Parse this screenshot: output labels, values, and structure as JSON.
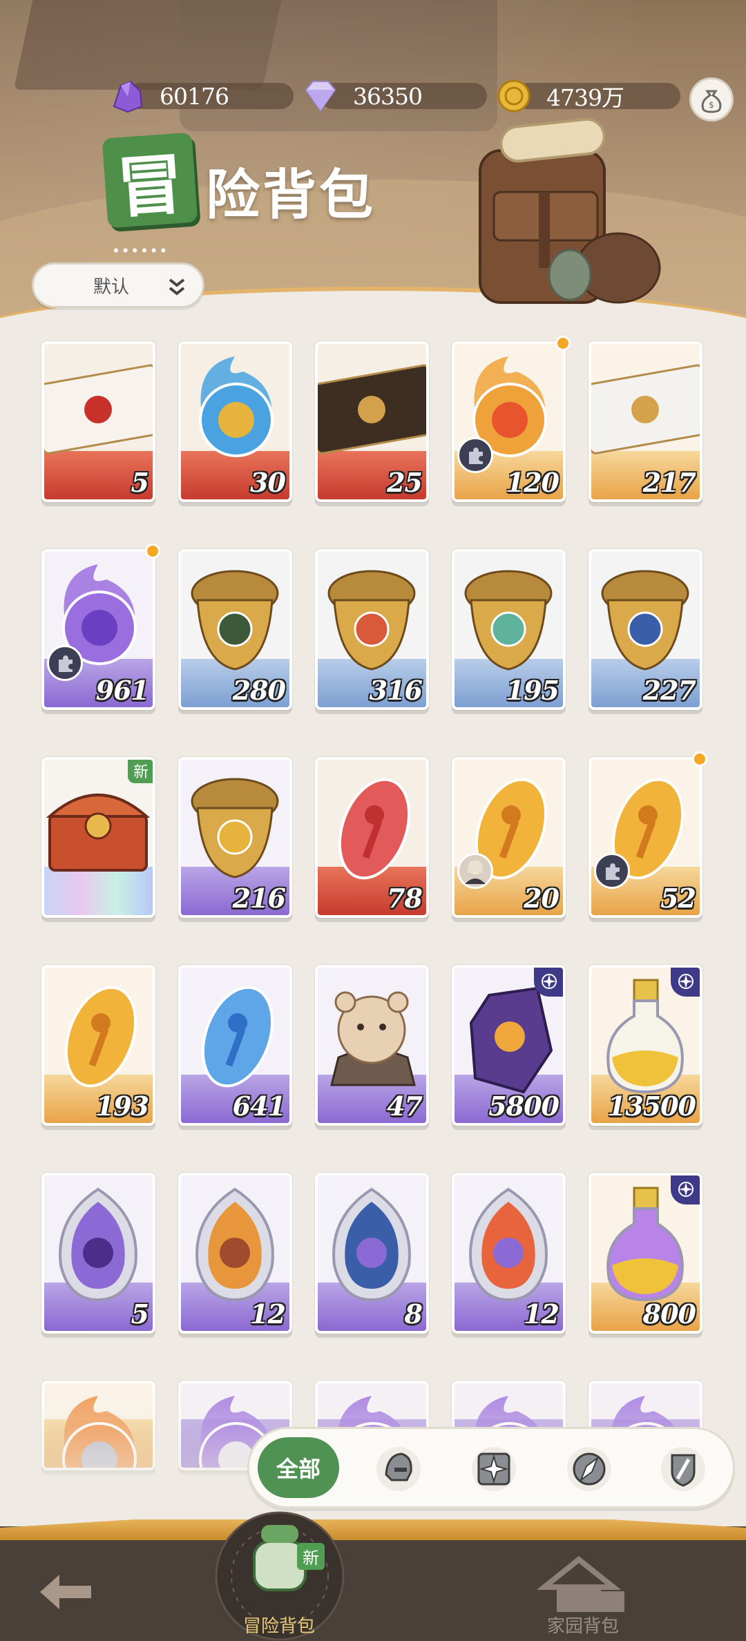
{
  "currencies": [
    {
      "name": "purple-crystal",
      "value": "60176",
      "color": "#8e5bd6"
    },
    {
      "name": "diamond",
      "value": "36350",
      "color": "#c9b8f0"
    },
    {
      "name": "gold-coin",
      "value": "4739万",
      "color": "#e0b030"
    }
  ],
  "title": {
    "badge": "冒",
    "rest": "险背包",
    "dots": "••••••"
  },
  "sort": {
    "label": "默认"
  },
  "items": [
    {
      "count": "5",
      "theme": "red",
      "art": "envelope-red",
      "dot": false,
      "puzzle": false
    },
    {
      "count": "30",
      "theme": "red",
      "art": "crystal-ball",
      "dot": false,
      "puzzle": false
    },
    {
      "count": "25",
      "theme": "red",
      "art": "envelope-dark",
      "dot": false,
      "puzzle": false
    },
    {
      "count": "120",
      "theme": "gold",
      "art": "fire-trident-orb",
      "dot": true,
      "puzzle": true
    },
    {
      "count": "217",
      "theme": "gold",
      "art": "envelope-white",
      "dot": false,
      "puzzle": false
    },
    {
      "count": "961",
      "theme": "purple",
      "art": "purple-trident-orb",
      "dot": true,
      "puzzle": true
    },
    {
      "count": "280",
      "theme": "blue",
      "art": "acorn-eye",
      "dot": false,
      "puzzle": false
    },
    {
      "count": "316",
      "theme": "blue",
      "art": "acorn-sun",
      "dot": false,
      "puzzle": false
    },
    {
      "count": "195",
      "theme": "blue",
      "art": "acorn-leaf",
      "dot": false,
      "puzzle": false
    },
    {
      "count": "227",
      "theme": "blue",
      "art": "acorn-star",
      "dot": false,
      "puzzle": false
    },
    {
      "count": "",
      "theme": "rainbow",
      "art": "treasure-chest",
      "dot": false,
      "puzzle": false,
      "new": "新"
    },
    {
      "count": "216",
      "theme": "purple",
      "art": "acorn-diamond",
      "dot": false,
      "puzzle": false
    },
    {
      "count": "78",
      "theme": "red",
      "art": "red-seed",
      "dot": false,
      "puzzle": false
    },
    {
      "count": "20",
      "theme": "gold",
      "art": "gold-seed",
      "dot": false,
      "puzzle": false,
      "portrait": true
    },
    {
      "count": "52",
      "theme": "gold",
      "art": "gold-seed",
      "dot": true,
      "puzzle": true
    },
    {
      "count": "193",
      "theme": "gold",
      "art": "gold-seed",
      "dot": false,
      "puzzle": false
    },
    {
      "count": "641",
      "theme": "purple",
      "art": "blue-seed",
      "dot": false,
      "puzzle": false
    },
    {
      "count": "47",
      "theme": "purple",
      "art": "hamster-rock",
      "dot": false,
      "puzzle": false
    },
    {
      "count": "5800",
      "theme": "purple",
      "art": "purple-gem",
      "dot": false,
      "puzzle": false,
      "badge": true
    },
    {
      "count": "13500",
      "theme": "gold",
      "art": "gold-potion",
      "dot": false,
      "puzzle": false,
      "badge": true
    },
    {
      "count": "5",
      "theme": "purple",
      "art": "egg-rune",
      "dot": false,
      "puzzle": false
    },
    {
      "count": "12",
      "theme": "purple",
      "art": "egg-flame",
      "dot": false,
      "puzzle": false
    },
    {
      "count": "8",
      "theme": "purple",
      "art": "egg-galaxy",
      "dot": false,
      "puzzle": false
    },
    {
      "count": "12",
      "theme": "purple",
      "art": "egg-fire",
      "dot": false,
      "puzzle": false
    },
    {
      "count": "800",
      "theme": "gold",
      "art": "purple-potion",
      "dot": false,
      "puzzle": false,
      "badge": true
    },
    {
      "count": "",
      "theme": "gold",
      "art": "fire-orb",
      "dot": false,
      "puzzle": false
    },
    {
      "count": "",
      "theme": "purple",
      "art": "purple-orb",
      "dot": false,
      "puzzle": false
    },
    {
      "count": "",
      "theme": "purple",
      "art": "purple-orb",
      "dot": false,
      "puzzle": false
    },
    {
      "count": "",
      "theme": "purple",
      "art": "purple-orb",
      "dot": false,
      "puzzle": false
    },
    {
      "count": "",
      "theme": "purple",
      "art": "purple-orb",
      "dot": false,
      "puzzle": false
    }
  ],
  "filter": {
    "all_label": "全部",
    "buttons": [
      "helmet-icon",
      "compass-star-icon",
      "compass-needle-icon",
      "sword-shield-icon"
    ]
  },
  "nav": {
    "back": "back-arrow-icon",
    "adventure_label": "冒险背包",
    "adventure_new": "新",
    "home_label": "家园背包"
  },
  "colors": {
    "accent_green": "#4f9254",
    "dot_orange": "#f5a623",
    "badge_navy": "#3f3a88"
  }
}
